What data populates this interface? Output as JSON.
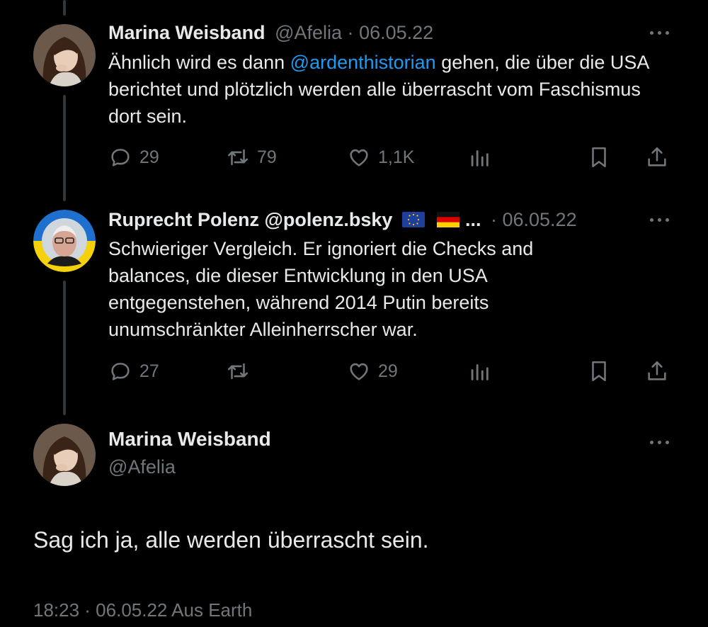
{
  "tweets": [
    {
      "name": "Marina Weisband",
      "handle": "@Afelia",
      "sep": "·",
      "date": "06.05.22",
      "text_before": "Ähnlich wird es dann ",
      "mention": "@ardenthistorian",
      "text_after": " gehen, die über die USA berichtet und plötzlich werden alle überrascht vom Faschismus dort sein.",
      "replies": "29",
      "retweets": "79",
      "likes": "1,1K"
    },
    {
      "name": "Ruprecht Polenz @polenz.bsky",
      "flags_suffix": "...",
      "sep": "·",
      "date": "06.05.22",
      "text": "Schwieriger Vergleich. Er ignoriert die Checks and balances, die dieser Entwicklung in den USA entgegenstehen, während 2014 Putin bereits unumschränkter Alleinherrscher war.",
      "replies": "27",
      "retweets": "",
      "likes": "29"
    }
  ],
  "focal": {
    "name": "Marina Weisband",
    "handle": "@Afelia",
    "text": "Sag ich ja, alle werden überrascht sein.",
    "meta": "18:23 · 06.05.22 Aus Earth"
  },
  "icons": [
    "reply-icon",
    "retweet-icon",
    "like-icon",
    "views-icon",
    "bookmark-icon",
    "share-icon",
    "more-icon",
    "eu-flag-icon",
    "germany-flag-icon"
  ],
  "colors": {
    "background": "#000000",
    "text": "#e7e9ea",
    "muted": "#71767b",
    "link": "#1d9bf0"
  }
}
